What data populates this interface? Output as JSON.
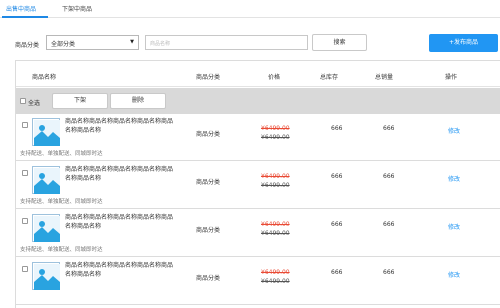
{
  "tabs": [
    {
      "label": "出售中商品",
      "active": true
    },
    {
      "label": "下架中商品",
      "active": false
    }
  ],
  "filter": {
    "label": "商品分类",
    "select_value": "全部分类",
    "search_placeholder": "商品名称",
    "search_button": "搜索",
    "publish_button": "+发布商品"
  },
  "table": {
    "headers": [
      "商品名称",
      "商品分类",
      "价格",
      "总库存",
      "总销量",
      "操作"
    ],
    "select_all": "全选",
    "bulk_actions": [
      "下架",
      "删除"
    ],
    "rows": [
      {
        "name": "商品名称商品名称商品名称商品名称商品名称商品名称",
        "note": "支持配送、单独配送、同城即时达",
        "category": "商品分类",
        "price": "¥6499.00",
        "old_price": "¥6499.00",
        "stock": "666",
        "sold": "666",
        "action": "修改"
      },
      {
        "name": "商品名称商品名称商品名称商品名称商品名称商品名称",
        "note": "支持配送、单独配送、同城即时达",
        "category": "商品分类",
        "price": "¥6499.00",
        "old_price": "¥6499.00",
        "stock": "666",
        "sold": "666",
        "action": "修改"
      },
      {
        "name": "商品名称商品名称商品名称商品名称商品名称商品名称",
        "note": "支持配送、单独配送、同城即时达",
        "category": "商品分类",
        "price": "¥6499.00",
        "old_price": "¥6499.00",
        "stock": "666",
        "sold": "666",
        "action": "修改"
      },
      {
        "name": "商品名称商品名称商品名称商品名称商品名称商品名称",
        "note": "",
        "category": "商品分类",
        "price": "¥6499.00",
        "old_price": "¥6499.00",
        "stock": "666",
        "sold": "666",
        "action": "修改"
      }
    ]
  },
  "colors": {
    "accent": "#2196f3",
    "price": "#e94b35",
    "thumb_sky": "#29a3e0"
  },
  "icons": {
    "thumbnail": "image-placeholder-icon",
    "dropdown": "caret-down-icon"
  }
}
